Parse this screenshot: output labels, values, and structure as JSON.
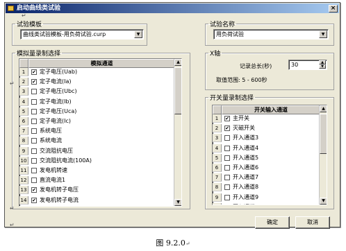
{
  "window": {
    "title": "启动曲线类试验",
    "close_glyph": "×"
  },
  "mark": "↵",
  "template": {
    "legend": "试验模板",
    "value": "曲线类试验模板-用负荷试验.curp"
  },
  "test_name": {
    "legend": "试验名称",
    "value": "用负荷试验"
  },
  "analog": {
    "legend": "模拟量录制选择",
    "header": "模拟通道",
    "rows": [
      {
        "n": "1",
        "checked": true,
        "label": "定子电压(Uab)"
      },
      {
        "n": "2",
        "checked": true,
        "label": "定子电流(Ia)"
      },
      {
        "n": "3",
        "checked": false,
        "label": "定子电压(Ubc)"
      },
      {
        "n": "4",
        "checked": false,
        "label": "定子电流(Ib)"
      },
      {
        "n": "5",
        "checked": false,
        "label": "定子电压(Uca)"
      },
      {
        "n": "6",
        "checked": false,
        "label": "定子电流(Ic)"
      },
      {
        "n": "7",
        "checked": false,
        "label": "系统电压"
      },
      {
        "n": "8",
        "checked": false,
        "label": "系统电流"
      },
      {
        "n": "9",
        "checked": false,
        "label": "交流阻抗电压"
      },
      {
        "n": "10",
        "checked": false,
        "label": "交流阻抗电流(100A)"
      },
      {
        "n": "11",
        "checked": false,
        "label": "发电机转速"
      },
      {
        "n": "12",
        "checked": false,
        "label": "直流电流1"
      },
      {
        "n": "13",
        "checked": true,
        "label": "发电机转子电压"
      },
      {
        "n": "14",
        "checked": true,
        "label": "发电机转子电流"
      }
    ]
  },
  "x_axis": {
    "legend": "X轴",
    "record_label": "记录总长(秒)",
    "record_value": "30",
    "range_label": "取值范围: 5 - 600秒"
  },
  "switch": {
    "legend": "开关量录制选择",
    "header": "开关输入通道",
    "rows": [
      {
        "n": "1",
        "checked": true,
        "label": "主开关"
      },
      {
        "n": "2",
        "checked": true,
        "label": "灭磁开关"
      },
      {
        "n": "3",
        "checked": false,
        "label": "开入通道3"
      },
      {
        "n": "4",
        "checked": false,
        "label": "开入通道4"
      },
      {
        "n": "5",
        "checked": false,
        "label": "开入通道5"
      },
      {
        "n": "6",
        "checked": false,
        "label": "开入通道6"
      },
      {
        "n": "7",
        "checked": false,
        "label": "开入通道7"
      },
      {
        "n": "8",
        "checked": false,
        "label": "开入通道8"
      },
      {
        "n": "9",
        "checked": false,
        "label": "开入通道9"
      },
      {
        "n": "10",
        "checked": false,
        "label": "开入通道10"
      }
    ]
  },
  "buttons": {
    "ok": "确定",
    "cancel": "取消"
  },
  "scroll": {
    "up": "▲",
    "down": "▼"
  },
  "caption": "图 9.2.0"
}
